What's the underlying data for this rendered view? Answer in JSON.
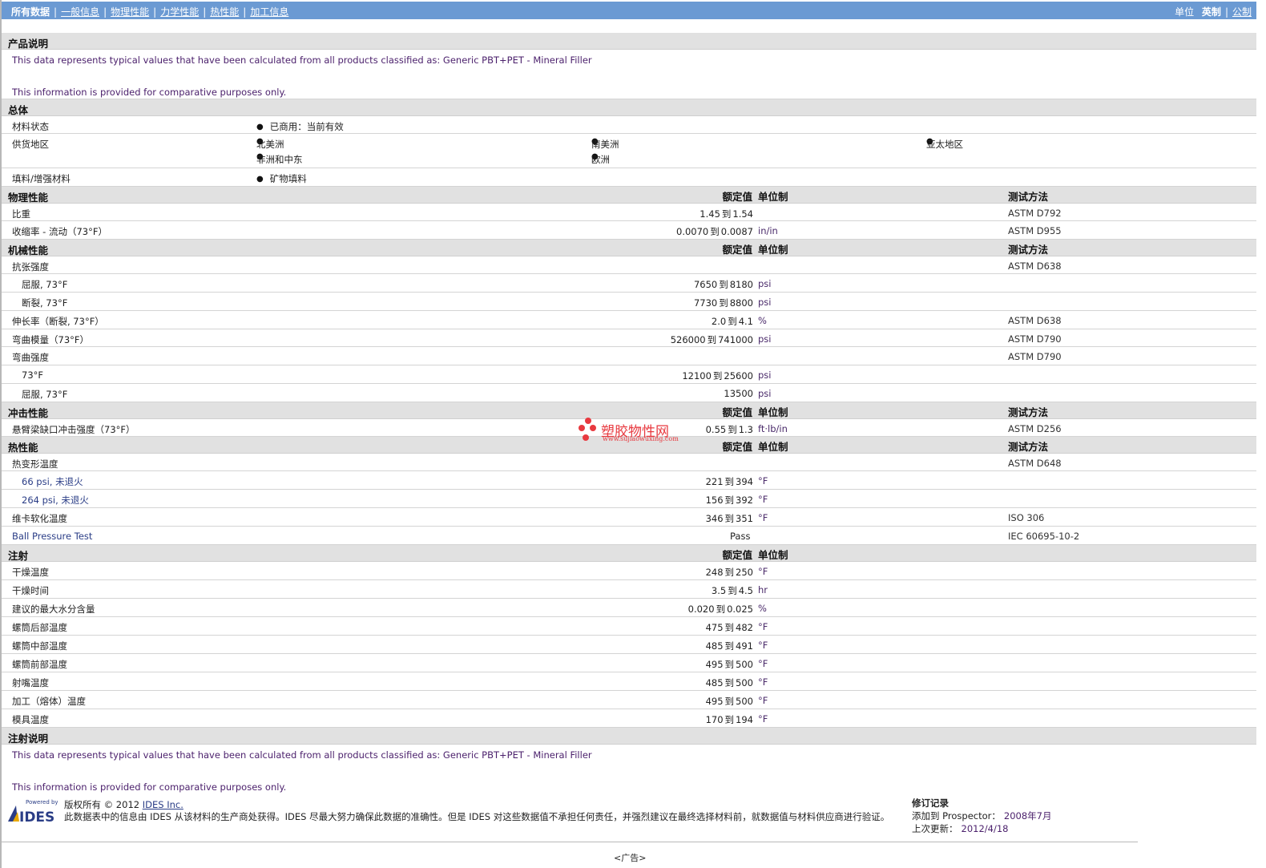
{
  "nav": {
    "all": "所有数据",
    "general": "一般信息",
    "physical": "物理性能",
    "optical": "力学性能",
    "thermal": "热性能",
    "processing": "加工信息",
    "unit_label": "单位",
    "english": "英制",
    "metric": "公制"
  },
  "product": {
    "title": "产品说明",
    "line1": "This data represents typical values that have been calculated from all products classified as: Generic PBT+PET - Mineral Filler",
    "line2": "This information is provided for comparative purposes only."
  },
  "general": {
    "title": "总体",
    "status_label": "材料状态",
    "status_value": "已商用：当前有效",
    "region_label": "供货地区",
    "regions": [
      "北美洲",
      "南美洲",
      "亚太地区",
      "非洲和中东",
      "欧洲"
    ],
    "filler_label": "填料/增强材料",
    "filler_value": "矿物填料"
  },
  "headers": {
    "nominal": "额定值",
    "unit": "单位制",
    "test": "测试方法"
  },
  "physical": {
    "title": "物理性能",
    "rows": [
      {
        "label": "比重",
        "low": "1.45",
        "to": "到",
        "high": "1.54",
        "unit": "",
        "test": "ASTM D792"
      },
      {
        "label": "收缩率 - 流动（73°F）",
        "low": "0.0070",
        "to": "到",
        "high": "0.0087",
        "unit": "in/in",
        "test": "ASTM D955"
      }
    ]
  },
  "mechanical": {
    "title": "机械性能",
    "tensile": "抗张强度",
    "tensile_test": "ASTM D638",
    "yield_label": "屈服, 73°F",
    "yield": {
      "low": "7650",
      "to": "到",
      "high": "8180",
      "unit": "psi"
    },
    "break_label": "断裂, 73°F",
    "break": {
      "low": "7730",
      "to": "到",
      "high": "8800",
      "unit": "psi"
    },
    "elong_label": "伸长率（断裂, 73°F）",
    "elong": {
      "low": "2.0",
      "to": "到",
      "high": "4.1",
      "unit": "%",
      "test": "ASTM D638"
    },
    "flexmod_label": "弯曲模量（73°F）",
    "flexmod": {
      "low": "526000",
      "to": "到",
      "high": "741000",
      "unit": "psi",
      "test": "ASTM D790"
    },
    "flexstr_label": "弯曲强度",
    "flexstr_test": "ASTM D790",
    "f73_label": "73°F",
    "f73": {
      "low": "12100",
      "to": "到",
      "high": "25600",
      "unit": "psi"
    },
    "fyield_label": "屈服, 73°F",
    "fyield": {
      "single": "13500",
      "unit": "psi"
    }
  },
  "impact": {
    "title": "冲击性能",
    "label": "悬臂梁缺口冲击强度（73°F）",
    "low": "0.55",
    "to": "到",
    "high": "1.3",
    "unit": "ft·lb/in",
    "test": "ASTM D256"
  },
  "thermal": {
    "title": "热性能",
    "hdt_label": "热变形温度",
    "hdt_test": "ASTM D648",
    "h66_label": "66 psi, 未退火",
    "h66": {
      "low": "221",
      "to": "到",
      "high": "394",
      "unit": "°F"
    },
    "h264_label": "264 psi, 未退火",
    "h264": {
      "low": "156",
      "to": "到",
      "high": "392",
      "unit": "°F"
    },
    "vicat_label": "维卡软化温度",
    "vicat": {
      "low": "346",
      "to": "到",
      "high": "351",
      "unit": "°F",
      "test": "ISO 306"
    },
    "ball_label": "Ball Pressure Test",
    "ball_value": "Pass",
    "ball_test": "IEC 60695-10-2"
  },
  "injection": {
    "title": "注射",
    "rows": [
      {
        "label": "干燥温度",
        "low": "248",
        "to": "到",
        "high": "250",
        "unit": "°F"
      },
      {
        "label": "干燥时间",
        "low": "3.5",
        "to": "到",
        "high": "4.5",
        "unit": "hr"
      },
      {
        "label": "建议的最大水分含量",
        "low": "0.020",
        "to": "到",
        "high": "0.025",
        "unit": "%"
      },
      {
        "label": "螺筒后部温度",
        "low": "475",
        "to": "到",
        "high": "482",
        "unit": "°F"
      },
      {
        "label": "螺筒中部温度",
        "low": "485",
        "to": "到",
        "high": "491",
        "unit": "°F"
      },
      {
        "label": "螺筒前部温度",
        "low": "495",
        "to": "到",
        "high": "500",
        "unit": "°F"
      },
      {
        "label": "射嘴温度",
        "low": "485",
        "to": "到",
        "high": "500",
        "unit": "°F"
      },
      {
        "label": "加工（熔体）温度",
        "low": "495",
        "to": "到",
        "high": "500",
        "unit": "°F"
      },
      {
        "label": "模具温度",
        "low": "170",
        "to": "到",
        "high": "194",
        "unit": "°F"
      }
    ]
  },
  "injection_notes": {
    "title": "注射说明",
    "line1": "This data represents typical values that have been calculated from all products classified as: Generic PBT+PET - Mineral Filler",
    "line2": "This information is provided for comparative purposes only."
  },
  "footer": {
    "logo_top": "Powered by",
    "logo_text": "IDES",
    "copyright": "版权所有 © 2012",
    "company_link": "IDES Inc.",
    "disclaimer": "此数据表中的信息由 IDES 从该材料的生产商处获得。IDES 尽最大努力确保此数据的准确性。但是 IDES 对这些数据值不承担任何责任，并强烈建议在最终选择材料前，就数据值与材料供应商进行验证。",
    "rev_title": "修订记录",
    "added_label": "添加到 Prospector：",
    "added_value": "2008年7月",
    "updated_label": "上次更新：",
    "updated_value": "2012/4/18",
    "ad": "<广告>"
  },
  "watermark": {
    "name": "塑胶物性网",
    "url": "www.sujiaowuxing.com"
  }
}
